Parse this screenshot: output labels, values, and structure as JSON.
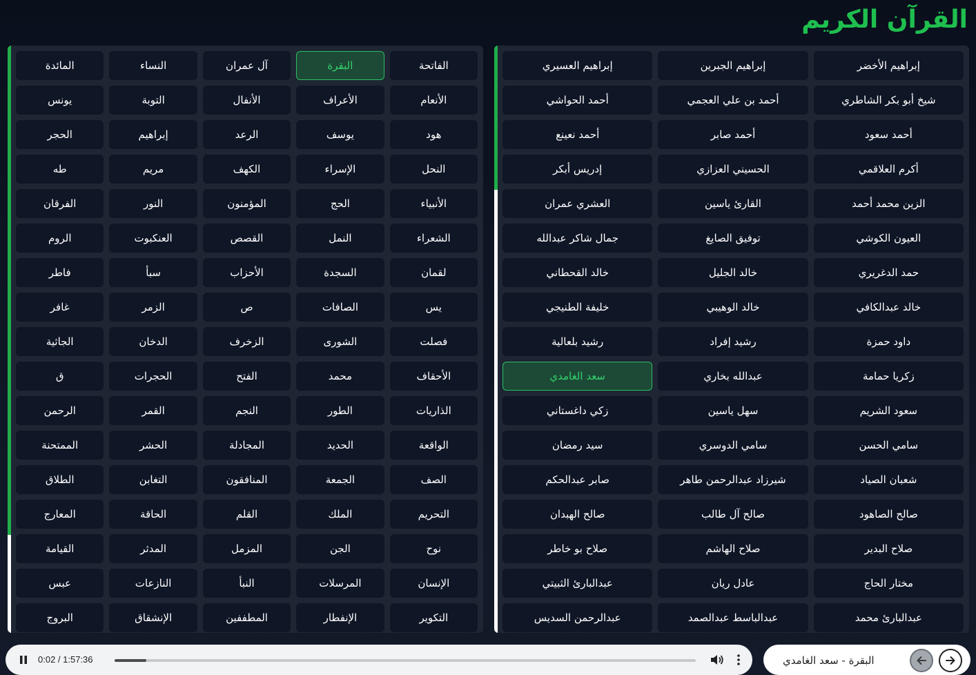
{
  "app": {
    "title": "القرآن الكريم"
  },
  "reciters": [
    "إبراهيم الأخضر",
    "إبراهيم الجبرين",
    "إبراهيم العسيري",
    "شيخ أبو بكر الشاطري",
    "أحمد بن علي العجمي",
    "أحمد الحواشي",
    "أحمد سعود",
    "أحمد صابر",
    "أحمد نعينع",
    "أكرم العلاقمي",
    "الحسيني العزازي",
    "إدريس أبكر",
    "الزين محمد أحمد",
    "القارئ ياسين",
    "العشري عمران",
    "العيون الكوشي",
    "توفيق الصايغ",
    "جمال شاكر عبدالله",
    "حمد الدغريري",
    "خالد الجليل",
    "خالد القحطاني",
    "خالد عبدالكافي",
    "خالد الوهيبي",
    "خليفة الطنيجي",
    "داود حمزة",
    "رشيد إفراد",
    "رشيد بلعالية",
    "زكريا حمامة",
    "عبدالله بخاري",
    "سعد الغامدي",
    "سعود الشريم",
    "سهل ياسين",
    "زكي داغستاني",
    "سامي الحسن",
    "سامي الدوسري",
    "سيد رمضان",
    "شعبان الصياد",
    "شيرزاد عبدالرحمن طاهر",
    "صابر عبدالحكم",
    "صالح الصاهود",
    "صالح آل طالب",
    "صالح الهبدان",
    "صلاح البدير",
    "صلاح الهاشم",
    "صلاح بو خاطر",
    "مختار الحاج",
    "عادل ريان",
    "عبدالبارئ الثبيتي",
    "عبدالبارئ محمد",
    "عبدالباسط عبدالصمد",
    "عبدالرحمن السديس"
  ],
  "surahs": [
    "الفاتحة",
    "البقرة",
    "آل عمران",
    "النساء",
    "المائدة",
    "الأنعام",
    "الأعراف",
    "الأنفال",
    "التوبة",
    "يونس",
    "هود",
    "يوسف",
    "الرعد",
    "إبراهيم",
    "الحجر",
    "النحل",
    "الإسراء",
    "الكهف",
    "مريم",
    "طه",
    "الأنبياء",
    "الحج",
    "المؤمنون",
    "النور",
    "الفرقان",
    "الشعراء",
    "النمل",
    "القصص",
    "العنكبوت",
    "الروم",
    "لقمان",
    "السجدة",
    "الأحزاب",
    "سبأ",
    "فاطر",
    "يس",
    "الصافات",
    "ص",
    "الزمر",
    "غافر",
    "فصلت",
    "الشورى",
    "الزخرف",
    "الدخان",
    "الجاثية",
    "الأحقاف",
    "محمد",
    "الفتح",
    "الحجرات",
    "ق",
    "الذاريات",
    "الطور",
    "النجم",
    "القمر",
    "الرحمن",
    "الواقعة",
    "الحديد",
    "المجادلة",
    "الحشر",
    "الممتحنة",
    "الصف",
    "الجمعة",
    "المنافقون",
    "التغابن",
    "الطلاق",
    "التحريم",
    "الملك",
    "القلم",
    "الحاقة",
    "المعارج",
    "نوح",
    "الجن",
    "المزمل",
    "المدثر",
    "القيامة",
    "الإنسان",
    "المرسلات",
    "النبأ",
    "النازعات",
    "عبس",
    "التكوير",
    "الإنفطار",
    "المطففين",
    "الإنشقاق",
    "البروج"
  ],
  "selection": {
    "reciter": "سعد الغامدي",
    "surah": "البقرة"
  },
  "player": {
    "time": "0:02 / 1:57:36",
    "progress_fraction": 0.0003
  },
  "now_playing": {
    "text": "البقرة - سعد الغامدي"
  },
  "icons": {
    "play": "pause-icon",
    "volume": "volume-icon",
    "more": "more-vert-icon",
    "prev": "arrow-left-icon",
    "next": "arrow-right-icon"
  },
  "colors": {
    "accent": "#1fbf4f",
    "panel": "#1e2533",
    "button": "#0f1626",
    "active_bg": "#1c4a36"
  }
}
